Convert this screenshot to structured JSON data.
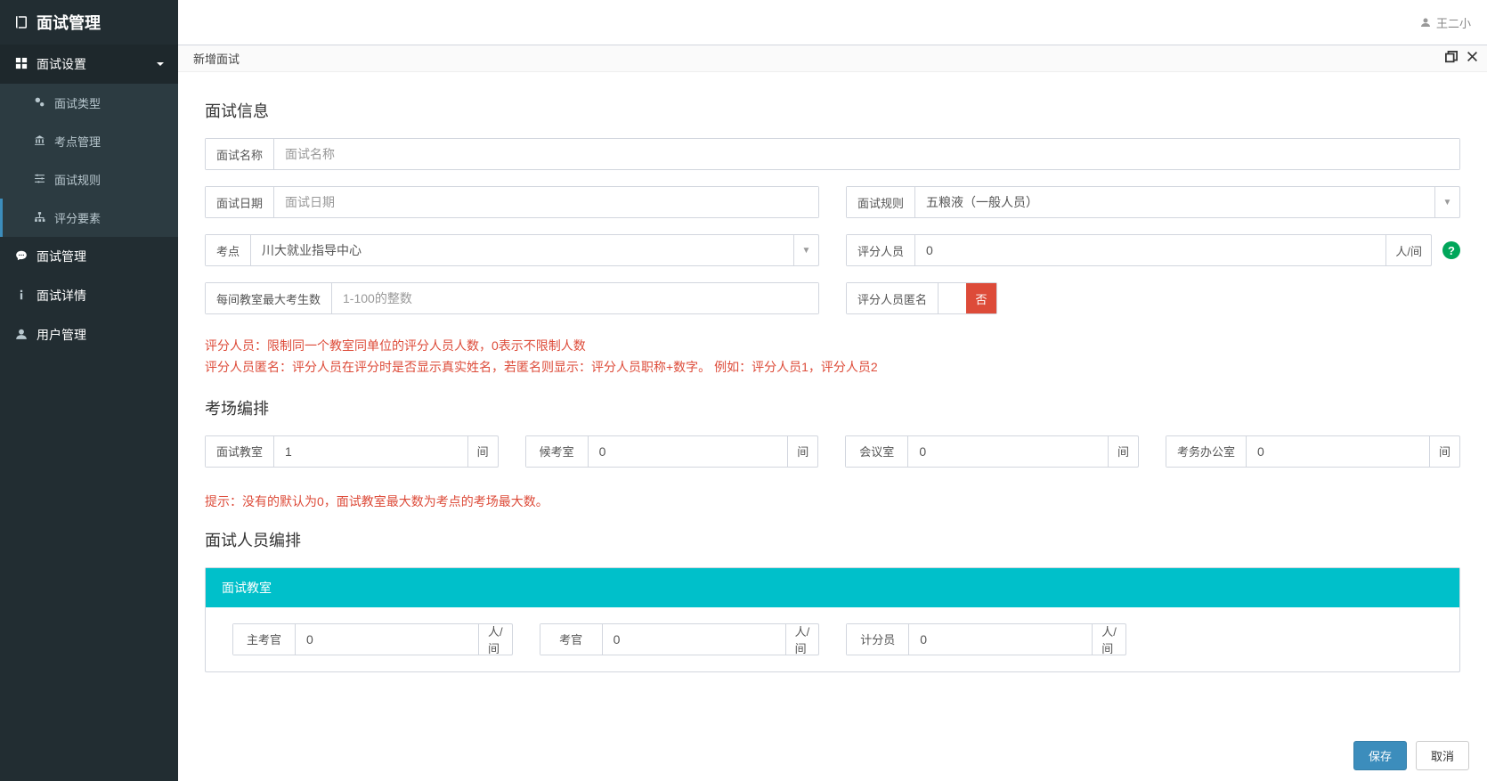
{
  "brand": "面试管理",
  "user_name": "王二小",
  "sidebar": {
    "interview_settings": "面试设置",
    "interview_type": "面试类型",
    "site_mgmt": "考点管理",
    "interview_rules": "面试规则",
    "score_elements": "评分要素",
    "interview_mgmt": "面试管理",
    "interview_detail": "面试详情",
    "user_mgmt": "用户管理"
  },
  "panel": {
    "title": "新增面试",
    "save": "保存",
    "cancel": "取消"
  },
  "section": {
    "info": "面试信息",
    "room": "考场编排",
    "people": "面试人员编排"
  },
  "form": {
    "name_label": "面试名称",
    "name_placeholder": "面试名称",
    "date_label": "面试日期",
    "date_placeholder": "面试日期",
    "rule_label": "面试规则",
    "rule_value": "五粮液（一般人员）",
    "site_label": "考点",
    "site_value": "川大就业指导中心",
    "scorer_label": "评分人员",
    "scorer_value": "0",
    "scorer_unit": "人/间",
    "max_label": "每间教室最大考生数",
    "max_placeholder": "1-100的整数",
    "anon_label": "评分人员匿名",
    "anon_value": "否",
    "hint1": "评分人员：限制同一个教室同单位的评分人员人数，0表示不限制人数",
    "hint2": "评分人员匿名：评分人员在评分时是否显示真实姓名，若匿名则显示：评分人员职称+数字。 例如：评分人员1，评分人员2"
  },
  "rooms": {
    "interview_room": "面试教室",
    "interview_room_val": "1",
    "waiting_room": "候考室",
    "waiting_room_val": "0",
    "meeting_room": "会议室",
    "meeting_room_val": "0",
    "office_room": "考务办公室",
    "office_room_val": "0",
    "unit": "间",
    "hint": "提示：没有的默认为0，面试教室最大数为考点的考场最大数。"
  },
  "people": {
    "tab_title": "面试教室",
    "main_examiner": "主考官",
    "main_examiner_val": "0",
    "examiner": "考官",
    "examiner_val": "0",
    "scorer": "计分员",
    "scorer_val": "0",
    "unit": "人/间"
  }
}
